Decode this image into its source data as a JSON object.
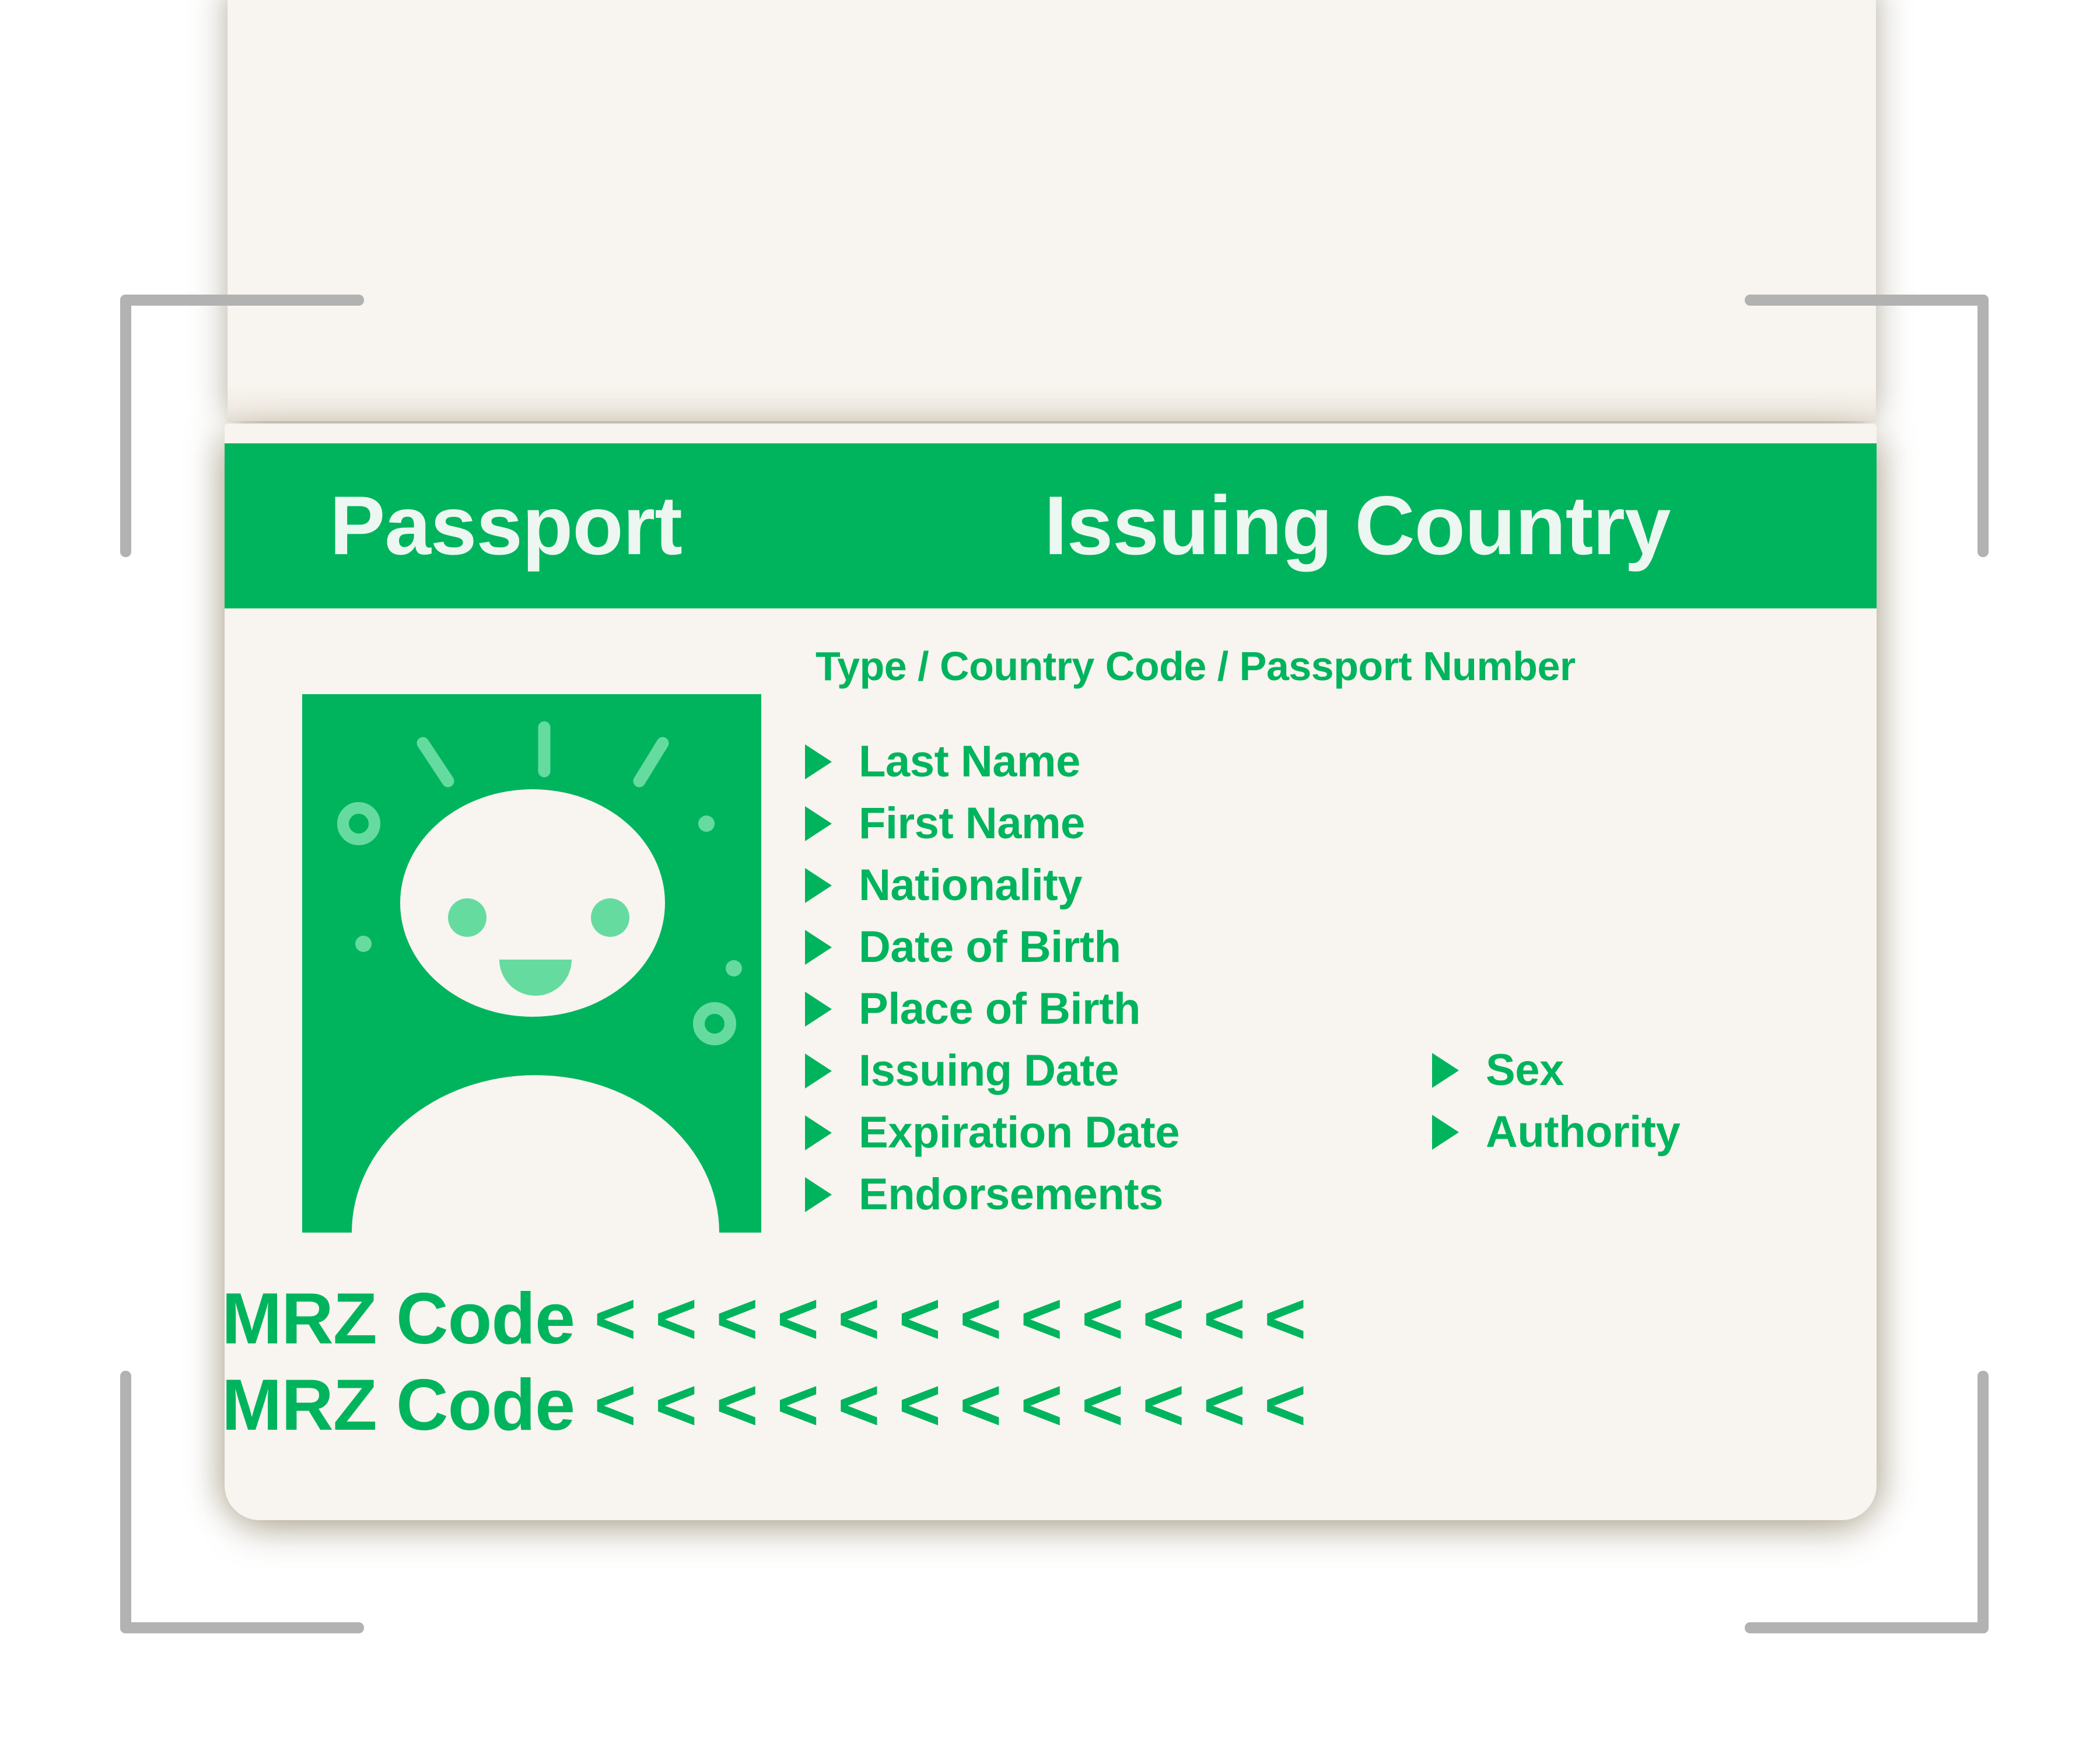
{
  "document": {
    "kind": "passport-scan-placeholder",
    "header": {
      "left_title": "Passport",
      "right_title": "Issuing Country"
    },
    "subtitle": "Type / Country Code / Passport Number",
    "photo": {
      "alt": "person-avatar-placeholder"
    },
    "fields_main": [
      {
        "label": "Last Name"
      },
      {
        "label": "First Name"
      },
      {
        "label": "Nationality"
      },
      {
        "label": "Date of Birth"
      },
      {
        "label": "Place of Birth"
      },
      {
        "label": "Issuing Date"
      },
      {
        "label": "Expiration Date"
      },
      {
        "label": "Endorsements"
      }
    ],
    "fields_side": [
      {
        "label": "Sex"
      },
      {
        "label": "Authority"
      }
    ],
    "mrz": [
      {
        "label": "MRZ Code",
        "chevrons": "<<<<<<<<<<<<"
      },
      {
        "label": "MRZ Code",
        "chevrons": "<<<<<<<<<<<<"
      }
    ]
  },
  "colors": {
    "green": "#00b45d",
    "green_light": "#66dba0",
    "paper": "#f8f4ef",
    "header_text": "#edf7f1",
    "bracket_gray": "#b2b2b2",
    "background": "#ffffff"
  },
  "scanner": {
    "corners": [
      "top-left",
      "top-right",
      "bottom-left",
      "bottom-right"
    ]
  }
}
